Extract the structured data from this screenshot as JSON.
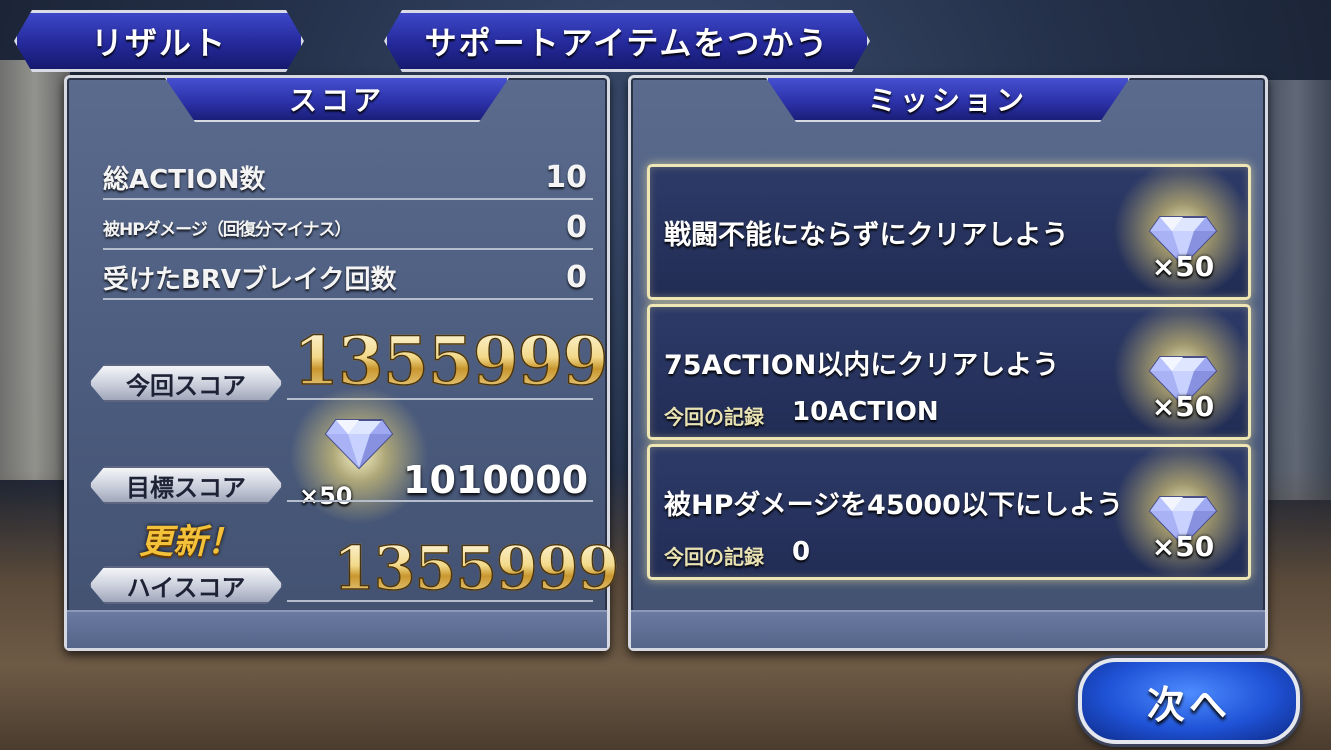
{
  "tabs": {
    "result": "リザルト",
    "support_item": "サポートアイテムをつかう"
  },
  "score_panel": {
    "header": "スコア",
    "stats": [
      {
        "label": "総ACTION数",
        "value": "10"
      },
      {
        "label": "被HPダメージ（回復分マイナス）",
        "value": "0"
      },
      {
        "label": "受けたBRVブレイク回数",
        "value": "0"
      }
    ],
    "current_score_label": "今回スコア",
    "current_score": "1355999",
    "target_score_label": "目標スコア",
    "target_score": "1010000",
    "target_reward_qty": "×50",
    "updated_label": "更新！",
    "high_score_label": "ハイスコア",
    "high_score": "1355999"
  },
  "mission_panel": {
    "header": "ミッション",
    "record_label": "今回の記録",
    "missions": [
      {
        "text": "戦闘不能にならずにクリアしよう",
        "record": "",
        "reward_qty": "×50"
      },
      {
        "text": "75ACTION以内にクリアしよう",
        "record": "10ACTION",
        "reward_qty": "×50"
      },
      {
        "text": "被HPダメージを45000以下にしよう",
        "record": "0",
        "reward_qty": "×50"
      }
    ]
  },
  "next_button": "次へ",
  "icons": {
    "reward_gem": "diamond-gem-icon"
  },
  "colors": {
    "panel_header": "#2a30a6",
    "mission_border": "#eee6b4",
    "next_button": "#1f52d6",
    "updated_text": "#f3c23a"
  }
}
